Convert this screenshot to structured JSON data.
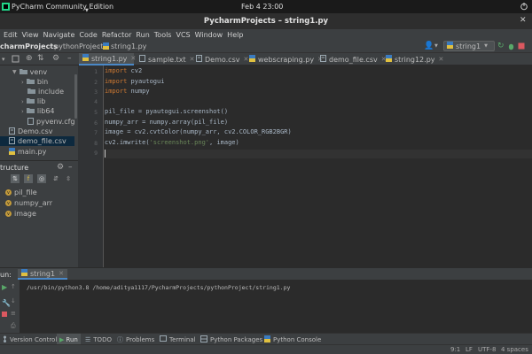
{
  "system": {
    "app_label": "PyCharm Community Edition",
    "clock": "Feb 4  23:00"
  },
  "window": {
    "title": "PycharmProjects – string1.py"
  },
  "menu": [
    "Edit",
    "View",
    "Navigate",
    "Code",
    "Refactor",
    "Run",
    "Tools",
    "VCS",
    "Window",
    "Help"
  ],
  "breadcrumb": {
    "root": "charmProjects",
    "project": "pythonProject",
    "file": "string1.py"
  },
  "run_config": {
    "name": "string1"
  },
  "tabs": [
    {
      "label": "string1.py"
    },
    {
      "label": "sample.txt"
    },
    {
      "label": "Demo.csv"
    },
    {
      "label": "webscraping.py"
    },
    {
      "label": "demo_file.csv"
    },
    {
      "label": "string12.py"
    }
  ],
  "project_tree": [
    {
      "label": "venv"
    },
    {
      "label": "bin"
    },
    {
      "label": "include"
    },
    {
      "label": "lib"
    },
    {
      "label": "lib64"
    },
    {
      "label": "pyvenv.cfg"
    },
    {
      "label": "Demo.csv"
    },
    {
      "label": "demo_file.csv"
    },
    {
      "label": "main.py"
    }
  ],
  "structure": {
    "title": "tructure",
    "items": [
      "pil_file",
      "numpy_arr",
      "image"
    ]
  },
  "editor": {
    "line_numbers": [
      "1",
      "2",
      "3",
      "4",
      "5",
      "6",
      "7",
      "8",
      "9"
    ],
    "lines": [
      {
        "kw": "import",
        "rest": " cv2"
      },
      {
        "kw": "import",
        "rest": " pyautogui"
      },
      {
        "kw": "import",
        "rest": " numpy"
      },
      {
        "kw": "",
        "rest": ""
      },
      {
        "kw": "",
        "rest": "pil_file = pyautogui.screenshot()"
      },
      {
        "kw": "",
        "rest": "numpy_arr = numpy.array(pil_file)"
      },
      {
        "kw": "",
        "rest": "image = cv2.cvtColor(numpy_arr, cv2.COLOR_RGB2BGR)"
      },
      {
        "kw": "",
        "rest": "cv2.imwrite(",
        "str": "'screenshot.png'",
        "tail": ", image)"
      },
      {
        "kw": "",
        "rest": ""
      }
    ]
  },
  "run_panel": {
    "label": "un:",
    "tab": "string1",
    "output": "/usr/bin/python3.8 /home/aditya1117/PycharmProjects/pythonProject/string1.py"
  },
  "bottom_tabs": [
    "Version Control",
    "Run",
    "TODO",
    "Problems",
    "Terminal",
    "Python Packages",
    "Python Console"
  ],
  "status": {
    "position": "9:1",
    "line_sep": "LF",
    "encoding": "UTF-8",
    "indent": "4 spaces"
  },
  "colors": {
    "keyword": "#cc7832",
    "string": "#6a8759",
    "accent": "#4a88c7"
  }
}
